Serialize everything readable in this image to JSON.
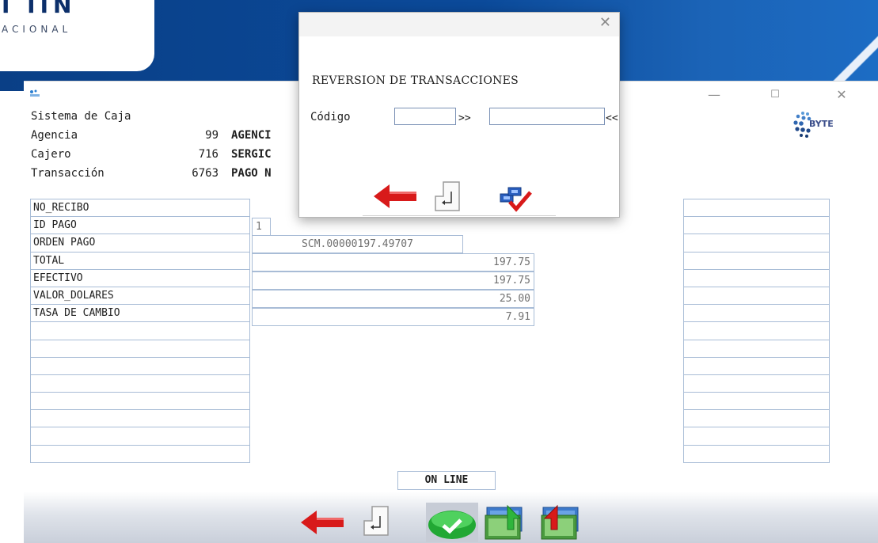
{
  "banner": {
    "logo_mark": "I IIN",
    "logo_text": "ACIONAL"
  },
  "window": {
    "app_icon": "BYTE",
    "minimize": "—",
    "maximize": "☐",
    "close": "✕"
  },
  "logo": {
    "text": "BYTE"
  },
  "info": {
    "system_label": "Sistema de Caja",
    "agencia_label": "Agencia",
    "agencia_num": "99",
    "agencia_val": "AGENCI",
    "cajero_label": "Cajero",
    "cajero_num": "716",
    "cajero_val": "SERGIC",
    "transaccion_label": "Transacción",
    "transaccion_num": "6763",
    "transaccion_val": "PAGO N"
  },
  "fields": [
    {
      "label": "NO_RECIBO",
      "value": ""
    },
    {
      "label": "ID PAGO",
      "value": "1"
    },
    {
      "label": "ORDEN PAGO",
      "value": "SCM.00000197.49707"
    },
    {
      "label": "TOTAL",
      "value": "197.75"
    },
    {
      "label": "EFECTIVO",
      "value": "197.75"
    },
    {
      "label": "VALOR_DOLARES",
      "value": "25.00"
    },
    {
      "label": "TASA DE CAMBIO",
      "value": "7.91"
    }
  ],
  "status": "ON LINE",
  "dialog": {
    "close": "✕",
    "title": "REVERSION DE TRANSACCIONES",
    "code_label": "Código",
    "code_from": "",
    "code_to": "",
    "sep1": ">>",
    "sep2": "<<"
  },
  "colors": {
    "accent_blue": "#0b4a9a",
    "arrow_red": "#d81a1a",
    "check_green": "#2fb53c",
    "grid_border": "#a8bcd6"
  },
  "icons": {
    "back": "arrow-left-icon",
    "enter": "enter-key-icon",
    "accept": "green-check-icon",
    "money_in": "money-deposit-icon",
    "money_out": "money-withdraw-icon",
    "confirm_users": "user-check-icon"
  }
}
